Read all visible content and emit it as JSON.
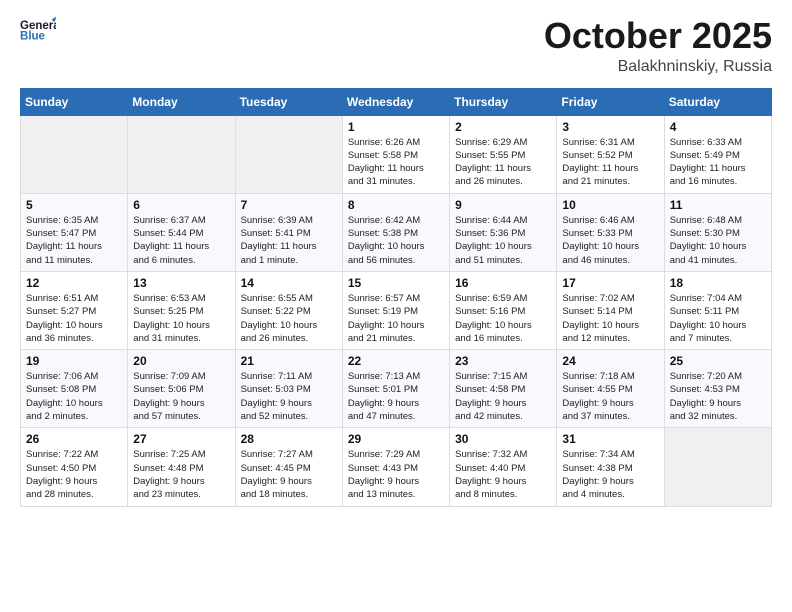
{
  "header": {
    "logo_line1": "General",
    "logo_line2": "Blue",
    "title": "October 2025",
    "location": "Balakhninskiy, Russia"
  },
  "days_of_week": [
    "Sunday",
    "Monday",
    "Tuesday",
    "Wednesday",
    "Thursday",
    "Friday",
    "Saturday"
  ],
  "weeks": [
    [
      {
        "day": "",
        "info": ""
      },
      {
        "day": "",
        "info": ""
      },
      {
        "day": "",
        "info": ""
      },
      {
        "day": "1",
        "info": "Sunrise: 6:26 AM\nSunset: 5:58 PM\nDaylight: 11 hours\nand 31 minutes."
      },
      {
        "day": "2",
        "info": "Sunrise: 6:29 AM\nSunset: 5:55 PM\nDaylight: 11 hours\nand 26 minutes."
      },
      {
        "day": "3",
        "info": "Sunrise: 6:31 AM\nSunset: 5:52 PM\nDaylight: 11 hours\nand 21 minutes."
      },
      {
        "day": "4",
        "info": "Sunrise: 6:33 AM\nSunset: 5:49 PM\nDaylight: 11 hours\nand 16 minutes."
      }
    ],
    [
      {
        "day": "5",
        "info": "Sunrise: 6:35 AM\nSunset: 5:47 PM\nDaylight: 11 hours\nand 11 minutes."
      },
      {
        "day": "6",
        "info": "Sunrise: 6:37 AM\nSunset: 5:44 PM\nDaylight: 11 hours\nand 6 minutes."
      },
      {
        "day": "7",
        "info": "Sunrise: 6:39 AM\nSunset: 5:41 PM\nDaylight: 11 hours\nand 1 minute."
      },
      {
        "day": "8",
        "info": "Sunrise: 6:42 AM\nSunset: 5:38 PM\nDaylight: 10 hours\nand 56 minutes."
      },
      {
        "day": "9",
        "info": "Sunrise: 6:44 AM\nSunset: 5:36 PM\nDaylight: 10 hours\nand 51 minutes."
      },
      {
        "day": "10",
        "info": "Sunrise: 6:46 AM\nSunset: 5:33 PM\nDaylight: 10 hours\nand 46 minutes."
      },
      {
        "day": "11",
        "info": "Sunrise: 6:48 AM\nSunset: 5:30 PM\nDaylight: 10 hours\nand 41 minutes."
      }
    ],
    [
      {
        "day": "12",
        "info": "Sunrise: 6:51 AM\nSunset: 5:27 PM\nDaylight: 10 hours\nand 36 minutes."
      },
      {
        "day": "13",
        "info": "Sunrise: 6:53 AM\nSunset: 5:25 PM\nDaylight: 10 hours\nand 31 minutes."
      },
      {
        "day": "14",
        "info": "Sunrise: 6:55 AM\nSunset: 5:22 PM\nDaylight: 10 hours\nand 26 minutes."
      },
      {
        "day": "15",
        "info": "Sunrise: 6:57 AM\nSunset: 5:19 PM\nDaylight: 10 hours\nand 21 minutes."
      },
      {
        "day": "16",
        "info": "Sunrise: 6:59 AM\nSunset: 5:16 PM\nDaylight: 10 hours\nand 16 minutes."
      },
      {
        "day": "17",
        "info": "Sunrise: 7:02 AM\nSunset: 5:14 PM\nDaylight: 10 hours\nand 12 minutes."
      },
      {
        "day": "18",
        "info": "Sunrise: 7:04 AM\nSunset: 5:11 PM\nDaylight: 10 hours\nand 7 minutes."
      }
    ],
    [
      {
        "day": "19",
        "info": "Sunrise: 7:06 AM\nSunset: 5:08 PM\nDaylight: 10 hours\nand 2 minutes."
      },
      {
        "day": "20",
        "info": "Sunrise: 7:09 AM\nSunset: 5:06 PM\nDaylight: 9 hours\nand 57 minutes."
      },
      {
        "day": "21",
        "info": "Sunrise: 7:11 AM\nSunset: 5:03 PM\nDaylight: 9 hours\nand 52 minutes."
      },
      {
        "day": "22",
        "info": "Sunrise: 7:13 AM\nSunset: 5:01 PM\nDaylight: 9 hours\nand 47 minutes."
      },
      {
        "day": "23",
        "info": "Sunrise: 7:15 AM\nSunset: 4:58 PM\nDaylight: 9 hours\nand 42 minutes."
      },
      {
        "day": "24",
        "info": "Sunrise: 7:18 AM\nSunset: 4:55 PM\nDaylight: 9 hours\nand 37 minutes."
      },
      {
        "day": "25",
        "info": "Sunrise: 7:20 AM\nSunset: 4:53 PM\nDaylight: 9 hours\nand 32 minutes."
      }
    ],
    [
      {
        "day": "26",
        "info": "Sunrise: 7:22 AM\nSunset: 4:50 PM\nDaylight: 9 hours\nand 28 minutes."
      },
      {
        "day": "27",
        "info": "Sunrise: 7:25 AM\nSunset: 4:48 PM\nDaylight: 9 hours\nand 23 minutes."
      },
      {
        "day": "28",
        "info": "Sunrise: 7:27 AM\nSunset: 4:45 PM\nDaylight: 9 hours\nand 18 minutes."
      },
      {
        "day": "29",
        "info": "Sunrise: 7:29 AM\nSunset: 4:43 PM\nDaylight: 9 hours\nand 13 minutes."
      },
      {
        "day": "30",
        "info": "Sunrise: 7:32 AM\nSunset: 4:40 PM\nDaylight: 9 hours\nand 8 minutes."
      },
      {
        "day": "31",
        "info": "Sunrise: 7:34 AM\nSunset: 4:38 PM\nDaylight: 9 hours\nand 4 minutes."
      },
      {
        "day": "",
        "info": ""
      }
    ]
  ]
}
